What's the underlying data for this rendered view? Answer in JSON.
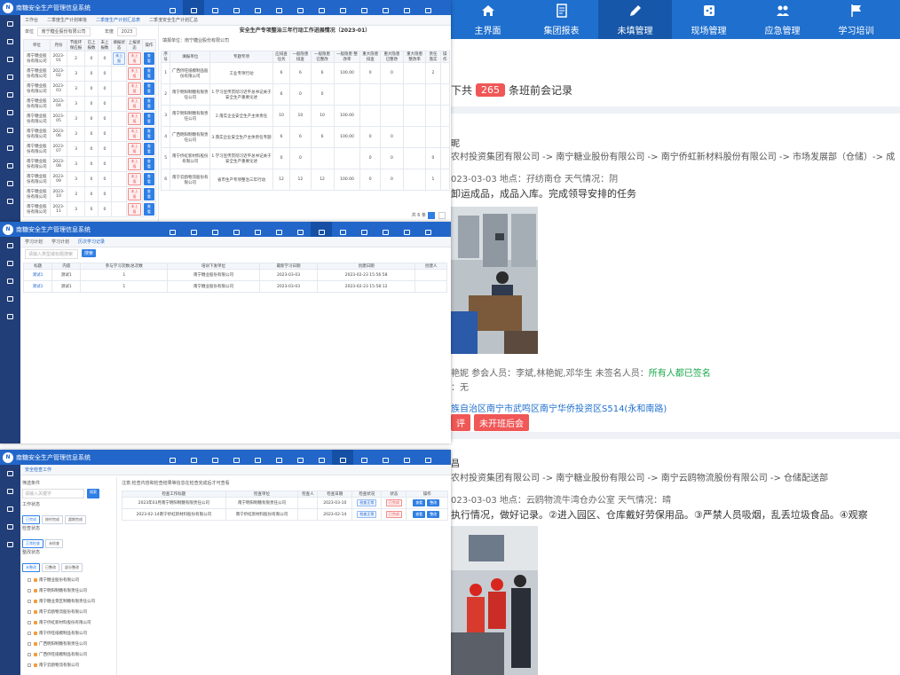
{
  "background_app": {
    "nav": [
      {
        "label": "主界面",
        "icon": "home-icon",
        "active": false
      },
      {
        "label": "集团报表",
        "icon": "report-icon",
        "active": false
      },
      {
        "label": "未填管理",
        "icon": "pencil-icon",
        "active": true
      },
      {
        "label": "现场管理",
        "icon": "share-icon",
        "active": false
      },
      {
        "label": "应急管理",
        "icon": "group-icon",
        "active": false
      },
      {
        "label": "学习培训",
        "icon": "flag-icon",
        "active": false
      }
    ],
    "summary": {
      "prefix": "下共",
      "count": "265",
      "suffix": "条班前会记录"
    },
    "records": [
      {
        "title_char": "昵",
        "path": "农村投资集团有限公司 -> 南宁糖业股份有限公司 -> 南宁侨虹新材料股份有限公司 -> 市场发展部（仓储）-> 成",
        "meta": "023-03-03    地点：孖纺南仓    天气情况：阴",
        "content": "卸运成品，成品入库。完成领导安排的任务",
        "people_prefix": "艳妮    参会人员：李斌,林艳妮,邓华生    未签名人员：",
        "people_status": "所有人都已签名",
        "other": "：无",
        "address": "族自治区南宁市武鸣区南宁华侨投资区S514(永和南路)",
        "tags": [
          "评",
          "未开班后会"
        ]
      },
      {
        "title_char": "昌",
        "path": "农村投资集团有限公司 -> 南宁糖业股份有限公司 -> 南宁云鸥物流股份有限公司 -> 仓储配送部",
        "meta": "023-03-03    地点：云鸥物流牛湾仓办公室    天气情况：晴",
        "content": "执行情况，做好记录。②进入园区、仓库戴好劳保用品。③严禁人员吸烟，乱丢垃圾食品。④观察"
      }
    ]
  },
  "panel1": {
    "system_title": "南糖安全生产管理信息系统",
    "tabs": [
      "工作台",
      "二季度生产计划审批",
      "二季度生产计划汇总表",
      "二季度安全生产计划汇总"
    ],
    "filter": {
      "unit_label": "单位",
      "unit_value": "南宁糖业股份有限公司",
      "year_label": "年度",
      "year_value": "2023"
    },
    "left_table": {
      "headers": [
        "单位",
        "月份",
        "节能环保应报",
        "已上报数",
        "未上报数",
        "填报状态",
        "上报状态",
        "操作"
      ],
      "rows": [
        [
          "南宁糖业股份有限公司",
          "2023-01",
          "2",
          "0",
          "0",
          "未上报",
          "未上报",
          "查看"
        ],
        [
          "南宁糖业股份有限公司",
          "2023-02",
          "3",
          "0",
          "0",
          "",
          "未上报",
          "查看"
        ],
        [
          "南宁糖业股份有限公司",
          "2023-03",
          "3",
          "0",
          "0",
          "",
          "未上报",
          "查看"
        ],
        [
          "南宁糖业股份有限公司",
          "2023-04",
          "3",
          "0",
          "0",
          "",
          "未上报",
          "查看"
        ],
        [
          "南宁糖业股份有限公司",
          "2023-05",
          "3",
          "0",
          "0",
          "",
          "未上报",
          "查看"
        ],
        [
          "南宁糖业股份有限公司",
          "2023-06",
          "3",
          "0",
          "0",
          "",
          "未上报",
          "查看"
        ],
        [
          "南宁糖业股份有限公司",
          "2023-07",
          "3",
          "0",
          "0",
          "",
          "未上报",
          "查看"
        ],
        [
          "南宁糖业股份有限公司",
          "2023-08",
          "3",
          "0",
          "0",
          "",
          "未上报",
          "查看"
        ],
        [
          "南宁糖业股份有限公司",
          "2023-09",
          "3",
          "0",
          "0",
          "",
          "未上报",
          "查看"
        ],
        [
          "南宁糖业股份有限公司",
          "2023-10",
          "3",
          "0",
          "0",
          "",
          "未上报",
          "查看"
        ],
        [
          "南宁糖业股份有限公司",
          "2023-11",
          "3",
          "0",
          "0",
          "",
          "未上报",
          "查看"
        ]
      ]
    },
    "right": {
      "title": "安全生产专项整治三年行动工作进展情况（2023-01）",
      "unit": "填报单位：南宁糖业股份有限公司",
      "headers": [
        "序号",
        "填报单位",
        "专题专项",
        "应排查任务",
        "一般隐患 排查",
        "一般隐患 已整改",
        "一般隐患 整改率",
        "重大隐患 排查",
        "重大隐患 已整改",
        "重大隐患 整改率",
        "责任落实",
        "操作"
      ],
      "rows": [
        [
          "1",
          "广西侨旺纸模制品股份有限公司",
          "工业专项行动",
          "6",
          "6",
          "6",
          "100.00",
          "0",
          "0",
          "",
          "2",
          ""
        ],
        [
          "2",
          "南宁明阳制糖有限责任公司",
          "1.学习宣传贯彻习近平总书记关于安全生产重要论述",
          "6",
          "0",
          "0",
          "",
          "",
          "",
          "",
          "",
          ""
        ],
        [
          "3",
          "南宁明阳制糖有限责任公司",
          "2.落实企业安全生产主体责任",
          "10",
          "10",
          "10",
          "100.00",
          "",
          "",
          "",
          "",
          ""
        ],
        [
          "4",
          "广西明阳制糖有限责任公司",
          "3.落实企业安全生产主体责任专题",
          "6",
          "6",
          "6",
          "100.00",
          "0",
          "0",
          "",
          "",
          ""
        ],
        [
          "5",
          "南宁侨虹新材料股份有限公司",
          "1.学习宣传贯彻习近平总书记关于安全生产重要论述",
          "0",
          "0",
          "",
          "",
          "0",
          "0",
          "",
          "0",
          ""
        ],
        [
          "6",
          "南宁云鸥物流股份有限公司",
          "省市生产专项整治三年行动",
          "12",
          "12",
          "12",
          "100.00",
          "0",
          "0",
          "",
          "1",
          ""
        ]
      ],
      "pager": "共 6 条"
    }
  },
  "panel2": {
    "system_title": "南糖安全生产管理信息系统",
    "tabs": [
      "学习计划",
      "学习计划",
      "历次学习记录"
    ],
    "search_placeholder": "请输入类型或标题搜索",
    "search_btn": "搜索",
    "headers": [
      "标题",
      "内容",
      "参与学习次数/总次数",
      "培训下发单位",
      "最新学习日期",
      "创建日期",
      "创建人"
    ],
    "rows": [
      [
        "测试1",
        "测试1",
        "1",
        "南宁糖业股份有限公司",
        "2023-03-03",
        "2023-02-23 15:56:58",
        ""
      ],
      [
        "测试1",
        "测试1",
        "1",
        "南宁糖业股份有限公司",
        "2023-03-03",
        "2023-02-23 15:58:12",
        ""
      ]
    ]
  },
  "panel3": {
    "system_title": "南糖安全生产管理信息系统",
    "tab": "安全检查工作",
    "tree_title": "筛选条件",
    "tree_search_placeholder": "请输入关键字",
    "tree_search_btn": "搜索",
    "filter_groups": [
      {
        "label": "工作状态",
        "chips": [
          "已完成",
          "按时完成",
          "超期完成"
        ]
      },
      {
        "label": "检查状态",
        "chips": [
          "正常检查",
          "未检查"
        ]
      },
      {
        "label": "整改状态",
        "chips": [
          "未整改",
          "已整改",
          "部分整改"
        ]
      }
    ],
    "tree_items": [
      "南宁糖业股份有限公司",
      "南宁明阳制糖有限责任公司",
      "南宁糖业景区制糖有限责任公司",
      "南宁云鸥物流股份有限公司",
      "南宁侨虹新材料股份有限公司",
      "南宁侨旺纸模制品有限公司",
      "广西明阳制糖有限责任公司",
      "广西侨旺纸模制品有限公司",
      "南宁云鸥物流有限公司"
    ],
    "notice": "注意:检查内容和检查结果等信息在检查完成后才可查看",
    "headers": [
      "检查工作标题",
      "检查单位",
      "检查人",
      "检查日期",
      "检查状况",
      "状态",
      "操作"
    ],
    "rows": [
      [
        "2023年03月南宁明阳制糖有限责任公司",
        "南宁明阳制糖有限责任公司",
        "",
        "2023-03-10",
        "检查正常",
        "已完成",
        "查看 整改"
      ],
      [
        "2023-02-14南宁侨虹新材料股份有限公司",
        "南宁侨虹新材料股份有限公司",
        "",
        "2023-02-14",
        "检查正常",
        "已完成",
        "查看 整改"
      ]
    ]
  }
}
